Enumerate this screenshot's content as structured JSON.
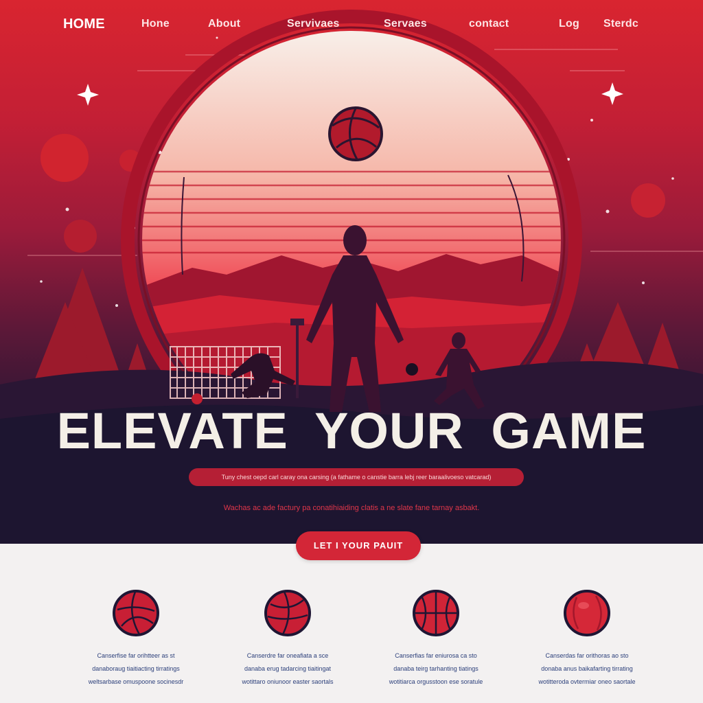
{
  "nav": {
    "brand": "HOME",
    "items": [
      "Hone",
      "About",
      "Servivaes",
      "Servaes",
      "contact",
      "Log",
      "Sterdc"
    ]
  },
  "hero": {
    "headline": "ELEVATE  YOUR GAME",
    "tagline": "Tuny chest oepd carl caray ona carsing (a fathame o canstie barra lebj reer baraalivoeso vatcarad)",
    "subtext": "Wachas ac ade factury pa conatihiaiding clatis a ne slate fane tarnay asbakt.",
    "cta_label": "LET I YOUR PAUIT"
  },
  "features": [
    {
      "icon": "volleyball-icon",
      "lines": [
        "Canserfise far orihtteer as st",
        "danaboraug tiaitiacting tirratings",
        "weltsarbase omuspoone socinesdr"
      ]
    },
    {
      "icon": "volleyball-icon",
      "lines": [
        "Canserdre far oneafiata a sce",
        "danaba erug tadarcing tiaitingat",
        "wotittaro oniunoor easter saortals"
      ]
    },
    {
      "icon": "basketball-icon",
      "lines": [
        "Canserfias far eniurosa ca sto",
        "danaba teirg tarhanting tiatings",
        "wotitiarca orgusstoon ese soratule"
      ]
    },
    {
      "icon": "ball-icon",
      "lines": [
        "Canserdas far orithoras ao sto",
        "donaba anus baikafarting tirrating",
        "wotitteroda ovtermiar oneo saortale"
      ]
    }
  ],
  "colors": {
    "accent": "#d32637",
    "hero_top": "#d92530",
    "hero_bottom": "#1d1530",
    "headline": "#f4efe7",
    "feature_text": "#2b3f7a"
  }
}
